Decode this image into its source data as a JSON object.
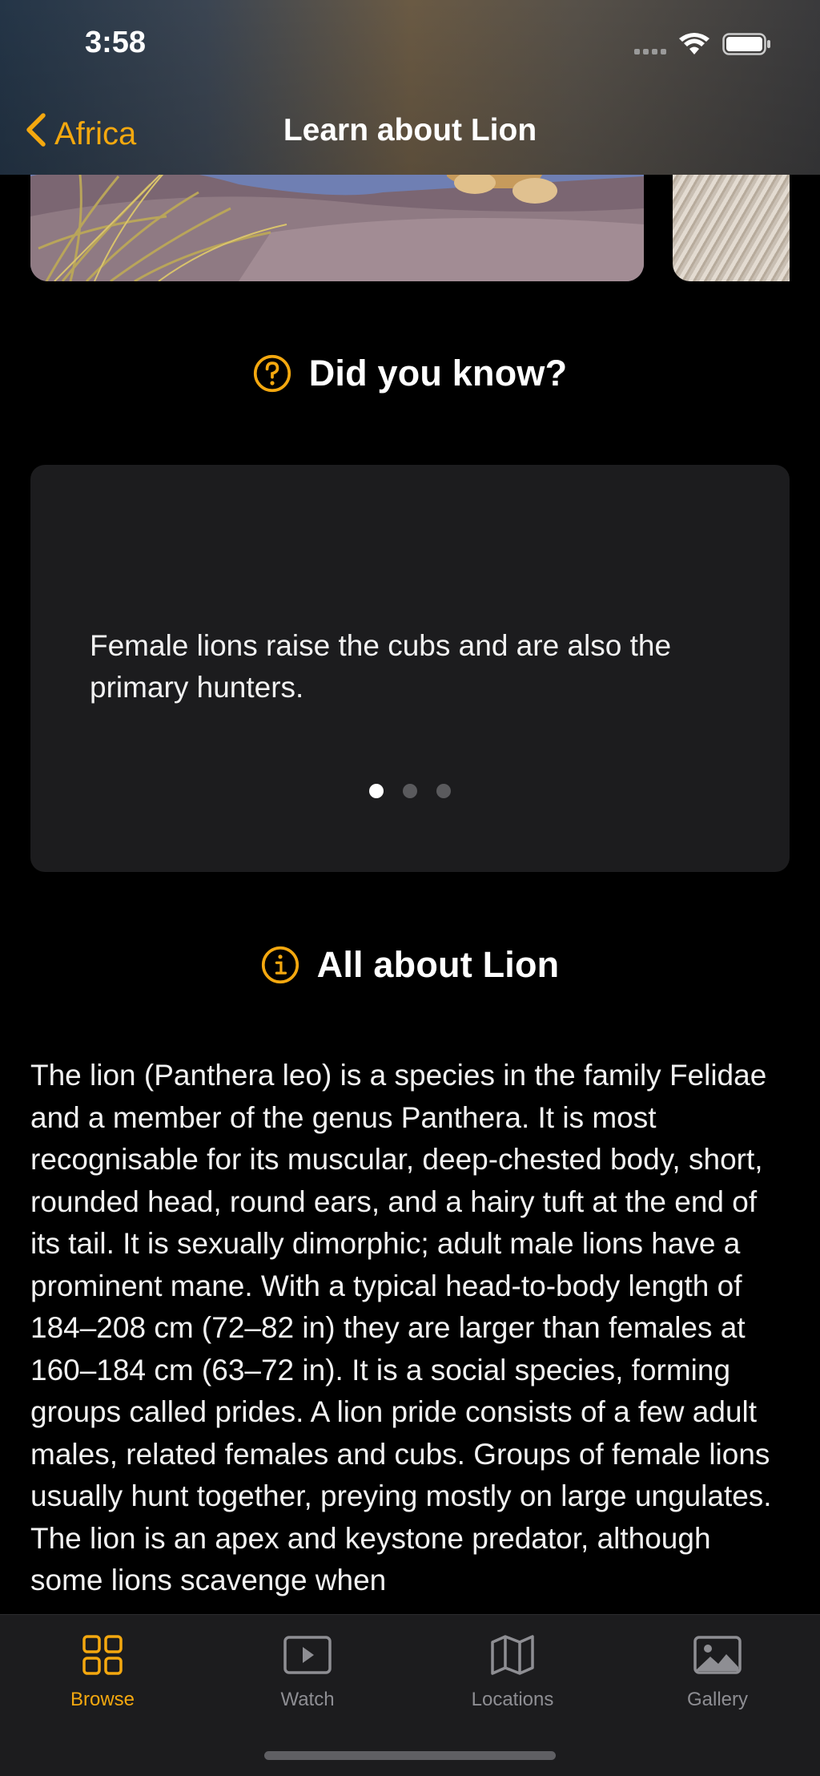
{
  "status_bar": {
    "time": "3:58"
  },
  "nav": {
    "back_label": "Africa",
    "title": "Learn about Lion"
  },
  "did_you_know": {
    "heading": "Did you know?",
    "icon": "question-circle-icon",
    "fact_text": "Female lions raise the cubs and are also the primary hunters.",
    "page_count": 3,
    "current_page": 1
  },
  "about": {
    "heading": "All about Lion",
    "icon": "info-circle-icon",
    "body": "The lion (Panthera leo) is a species in the family Felidae and a member of the genus Panthera. It is most recognisable for its muscular, deep-chested body, short, rounded head, round ears, and a hairy tuft at the end of its tail. It is sexually dimorphic; adult male lions have a prominent mane. With a typical head-to-body length of 184–208 cm (72–82 in) they are larger than females at 160–184 cm (63–72 in). It is a social species, forming groups called prides. A lion pride consists of a few adult males, related females and cubs. Groups of female lions usually hunt together, preying mostly on large ungulates. The lion is an apex and keystone predator, although some lions scavenge when"
  },
  "tabs": [
    {
      "label": "Browse",
      "icon": "grid-icon",
      "active": true
    },
    {
      "label": "Watch",
      "icon": "play-icon",
      "active": false
    },
    {
      "label": "Locations",
      "icon": "map-icon",
      "active": false
    },
    {
      "label": "Gallery",
      "icon": "photo-icon",
      "active": false
    }
  ],
  "colors": {
    "accent": "#f4a80f",
    "card_bg": "#1c1c1e",
    "inactive": "#8e8e93"
  }
}
